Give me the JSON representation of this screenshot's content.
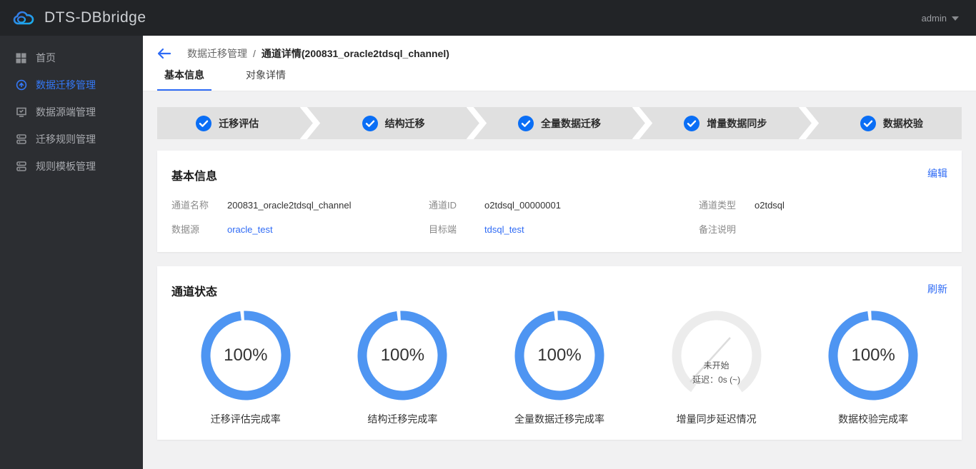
{
  "topbar": {
    "title": "DTS-DBbridge",
    "user": "admin"
  },
  "sidebar": {
    "items": [
      {
        "label": "首页",
        "active": false
      },
      {
        "label": "数据迁移管理",
        "active": true
      },
      {
        "label": "数据源端管理",
        "active": false
      },
      {
        "label": "迁移规则管理",
        "active": false
      },
      {
        "label": "规则模板管理",
        "active": false
      }
    ]
  },
  "breadcrumb": {
    "parent": "数据迁移管理",
    "separator": "/",
    "current": "通道详情(200831_oracle2tdsql_channel)"
  },
  "tabs": [
    {
      "label": "基本信息",
      "active": true
    },
    {
      "label": "对象详情",
      "active": false
    }
  ],
  "steps": [
    "迁移评估",
    "结构迁移",
    "全量数据迁移",
    "增量数据同步",
    "数据校验"
  ],
  "basic_info": {
    "title": "基本信息",
    "edit_label": "编辑",
    "rows": [
      [
        {
          "label": "通道名称",
          "value": "200831_oracle2tdsql_channel"
        },
        {
          "label": "通道ID",
          "value": "o2tdsql_00000001"
        },
        {
          "label": "通道类型",
          "value": "o2tdsql"
        }
      ],
      [
        {
          "label": "数据源",
          "value": "oracle_test",
          "link": true
        },
        {
          "label": "目标端",
          "value": "tdsql_test",
          "link": true
        },
        {
          "label": "备注说明",
          "value": ""
        }
      ]
    ]
  },
  "channel_status": {
    "title": "通道状态",
    "refresh_label": "刷新",
    "chart_data": [
      {
        "type": "donut",
        "value": 100,
        "display": "100%",
        "label": "迁移评估完成率",
        "color": "#4e95f2"
      },
      {
        "type": "donut",
        "value": 100,
        "display": "100%",
        "label": "结构迁移完成率",
        "color": "#4e95f2"
      },
      {
        "type": "donut",
        "value": 100,
        "display": "100%",
        "label": "全量数据迁移完成率",
        "color": "#4e95f2"
      },
      {
        "type": "gauge",
        "status": "未开始",
        "delay_text": "延迟：0s (~)",
        "label": "增量同步延迟情况",
        "color": "#ececec"
      },
      {
        "type": "donut",
        "value": 100,
        "display": "100%",
        "label": "数据校验完成率",
        "color": "#4e95f2"
      }
    ]
  },
  "colors": {
    "accent_check": "#0a6ef5",
    "link": "#2f6bf5",
    "donut_ring": "#4e95f2",
    "steps_band": "#e0e0e0",
    "sidebar_bg": "#2c2e32",
    "topbar_bg": "#222427"
  }
}
